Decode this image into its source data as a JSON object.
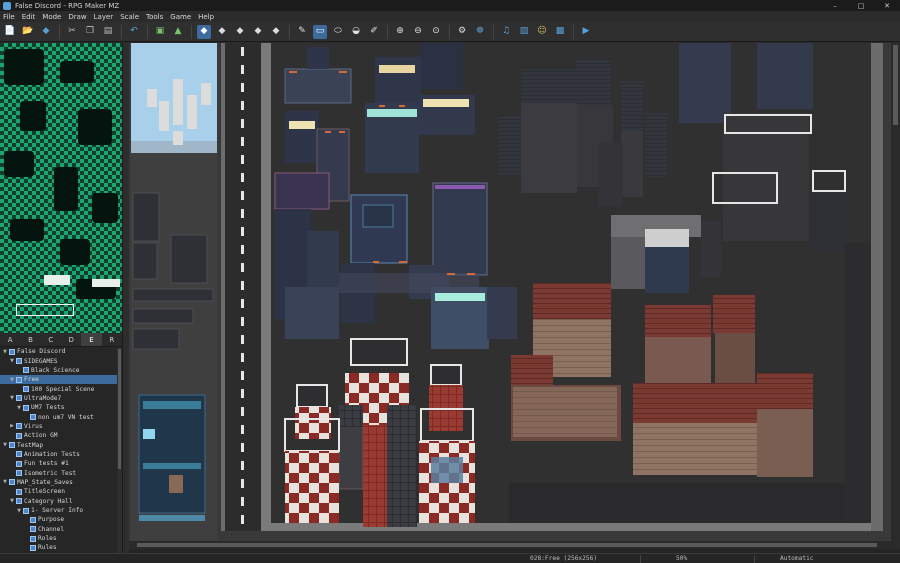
{
  "window": {
    "title": "False Discord - RPG Maker MZ",
    "controls": [
      "–",
      "□",
      "✕"
    ]
  },
  "menu": [
    "File",
    "Edit",
    "Mode",
    "Draw",
    "Layer",
    "Scale",
    "Tools",
    "Game",
    "Help"
  ],
  "toolbar": [
    {
      "name": "new-project-icon",
      "glyph": "📄",
      "color": "#f2f2f2"
    },
    {
      "name": "open-project-icon",
      "glyph": "📂",
      "color": "#5aa0d8"
    },
    {
      "name": "save-project-icon",
      "glyph": "◆",
      "color": "#5aa0d8"
    },
    {
      "sep": true
    },
    {
      "name": "cut-icon",
      "glyph": "✂",
      "color": "#bdbdbd"
    },
    {
      "name": "copy-icon",
      "glyph": "❐",
      "color": "#bdbdbd"
    },
    {
      "name": "paste-icon",
      "glyph": "▤",
      "color": "#bdbdbd"
    },
    {
      "sep": true
    },
    {
      "name": "undo-icon",
      "glyph": "↶",
      "color": "#5aa0d8"
    },
    {
      "sep": true
    },
    {
      "name": "map-mode-icon",
      "glyph": "▣",
      "color": "#7ac26b"
    },
    {
      "name": "event-mode-icon",
      "glyph": "▲",
      "color": "#7ac26b"
    },
    {
      "sep": true
    },
    {
      "name": "layer-auto-icon",
      "glyph": "◆",
      "color": "#ffffff",
      "active": true
    },
    {
      "name": "layer-1-icon",
      "glyph": "◆",
      "color": "#dcdcdc"
    },
    {
      "name": "layer-2-icon",
      "glyph": "◆",
      "color": "#dcdcdc"
    },
    {
      "name": "layer-3-icon",
      "glyph": "◆",
      "color": "#dcdcdc"
    },
    {
      "name": "layer-4-icon",
      "glyph": "◆",
      "color": "#dcdcdc"
    },
    {
      "sep": true
    },
    {
      "name": "pencil-icon",
      "glyph": "✎",
      "color": "#e0e0e0"
    },
    {
      "name": "rectangle-icon",
      "glyph": "▭",
      "color": "#ffffff",
      "active": true
    },
    {
      "name": "ellipse-icon",
      "glyph": "⬭",
      "color": "#e0e0e0"
    },
    {
      "name": "fill-icon",
      "glyph": "◒",
      "color": "#e0e0e0"
    },
    {
      "name": "shadow-pen-icon",
      "glyph": "✐",
      "color": "#e0e0e0"
    },
    {
      "sep": true
    },
    {
      "name": "zoom-in-icon",
      "glyph": "⊕",
      "color": "#e0e0e0"
    },
    {
      "name": "zoom-out-icon",
      "glyph": "⊖",
      "color": "#e0e0e0"
    },
    {
      "name": "zoom-actual-icon",
      "glyph": "⊙",
      "color": "#e0e0e0"
    },
    {
      "sep": true
    },
    {
      "name": "database-icon",
      "glyph": "⚙",
      "color": "#e0e0e0"
    },
    {
      "name": "plugin-manager-icon",
      "glyph": "☸",
      "color": "#5aa0d8"
    },
    {
      "sep": true
    },
    {
      "name": "sound-test-icon",
      "glyph": "♫",
      "color": "#5aa0d8"
    },
    {
      "name": "event-searcher-icon",
      "glyph": "▧",
      "color": "#5aa0d8"
    },
    {
      "name": "character-generator-icon",
      "glyph": "☺",
      "color": "#e0c060"
    },
    {
      "name": "resource-manager-icon",
      "glyph": "▩",
      "color": "#5aa0d8"
    },
    {
      "sep": true
    },
    {
      "name": "playtest-icon",
      "glyph": "▶",
      "color": "#5aa0d8"
    }
  ],
  "tileset_tabs": [
    "A",
    "B",
    "C",
    "D",
    "E",
    "R"
  ],
  "active_tab": "E",
  "map_tree": [
    {
      "depth": 0,
      "label": "False Discord",
      "toggle": "▼"
    },
    {
      "depth": 1,
      "label": "SIDEGAMES",
      "toggle": "▼"
    },
    {
      "depth": 2,
      "label": "Black Science",
      "toggle": ""
    },
    {
      "depth": 1,
      "label": "Free",
      "toggle": "▼",
      "selected": true
    },
    {
      "depth": 2,
      "label": "100 Special Scene",
      "toggle": ""
    },
    {
      "depth": 1,
      "label": "UltraMode7",
      "toggle": "▼"
    },
    {
      "depth": 2,
      "label": "UM7 Tests",
      "toggle": "▼"
    },
    {
      "depth": 3,
      "label": "non um7 VN test",
      "toggle": ""
    },
    {
      "depth": 1,
      "label": "Virus",
      "toggle": "▶"
    },
    {
      "depth": 1,
      "label": "Action GM",
      "toggle": ""
    },
    {
      "depth": 0,
      "label": "TestMap",
      "toggle": "▼"
    },
    {
      "depth": 1,
      "label": "Animation Tests",
      "toggle": ""
    },
    {
      "depth": 1,
      "label": "Fun tests #1",
      "toggle": ""
    },
    {
      "depth": 1,
      "label": "Isometric Test",
      "toggle": ""
    },
    {
      "depth": 0,
      "label": "MAP_State_Saves",
      "toggle": "▼"
    },
    {
      "depth": 1,
      "label": "TitleScreen",
      "toggle": ""
    },
    {
      "depth": 1,
      "label": "Category Hall",
      "toggle": "▼"
    },
    {
      "depth": 2,
      "label": "1- Server Info",
      "toggle": "▼"
    },
    {
      "depth": 3,
      "label": "Purpose",
      "toggle": ""
    },
    {
      "depth": 3,
      "label": "Channel",
      "toggle": ""
    },
    {
      "depth": 3,
      "label": "Roles",
      "toggle": ""
    },
    {
      "depth": 3,
      "label": "Rules",
      "toggle": ""
    }
  ],
  "status": {
    "map": "028:Free (256x256)",
    "zoom": "50%",
    "mode": "Automatic"
  }
}
